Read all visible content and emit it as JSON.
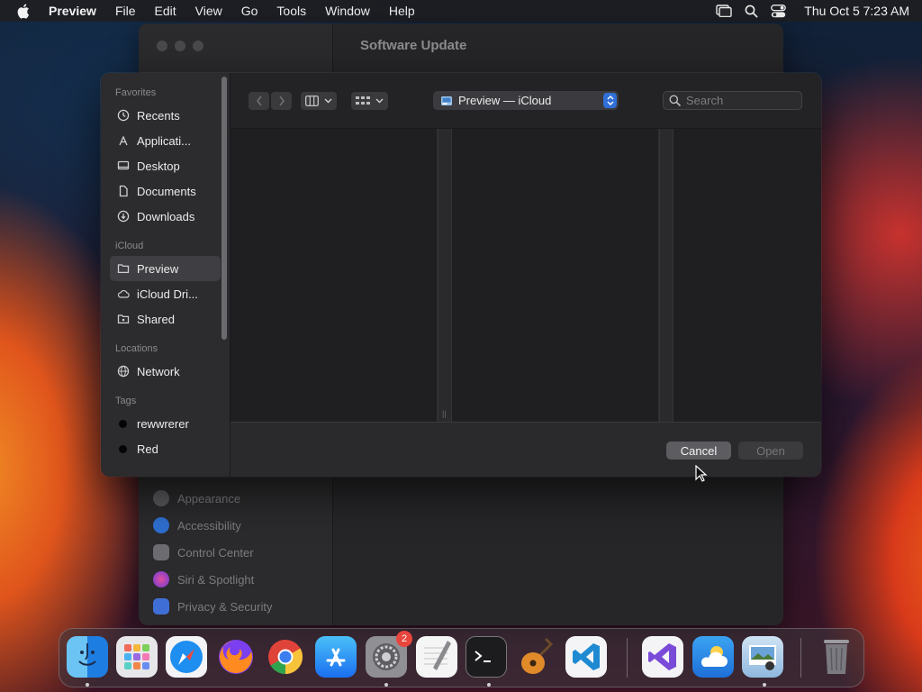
{
  "menubar": {
    "app": "Preview",
    "items": [
      "File",
      "Edit",
      "View",
      "Go",
      "Tools",
      "Window",
      "Help"
    ],
    "clock": "Thu Oct 5  7:23 AM",
    "status_icons": [
      "screen-mirroring-icon",
      "spotlight-search-icon",
      "control-center-icon"
    ]
  },
  "settings_window": {
    "title": "Software Update",
    "sidebar": [
      {
        "label": "Appearance",
        "color": "#5a5a5e"
      },
      {
        "label": "Accessibility",
        "color": "#2e6fd0"
      },
      {
        "label": "Control Center",
        "color": "#6c6c70"
      },
      {
        "label": "Siri & Spotlight",
        "color": "#b04ad8"
      },
      {
        "label": "Privacy & Security",
        "color": "#3f6fd6"
      }
    ]
  },
  "dialog": {
    "sidebar": {
      "favorites_header": "Favorites",
      "favorites": [
        "Recents",
        "Applicati...",
        "Desktop",
        "Documents",
        "Downloads"
      ],
      "icloud_header": "iCloud",
      "icloud": [
        "Preview",
        "iCloud Dri...",
        "Shared"
      ],
      "locations_header": "Locations",
      "locations": [
        "Network"
      ],
      "tags_header": "Tags",
      "tags": [
        "rewwrerer",
        "Red"
      ]
    },
    "location": "Preview — iCloud",
    "search_placeholder": "Search",
    "cancel_label": "Cancel",
    "open_label": "Open"
  },
  "dock": {
    "apps": [
      "Finder",
      "Launchpad",
      "Safari",
      "Firefox",
      "Chrome",
      "App Store",
      "System Settings",
      "TextEdit",
      "Terminal",
      "GarageBand",
      "Visual Studio Code",
      "Visual Studio",
      "Weather",
      "Preview",
      "Trash"
    ],
    "settings_badge": "2"
  }
}
